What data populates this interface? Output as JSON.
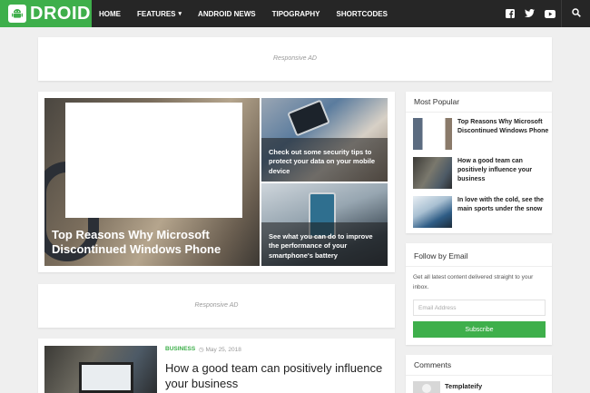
{
  "brand": {
    "name": "DROID",
    "accent_color": "#3eaf4b",
    "logo_icon": "android-icon"
  },
  "nav": {
    "items": [
      {
        "label": "HOME"
      },
      {
        "label": "FEATURES",
        "icon": "chevron-down-icon"
      },
      {
        "label": "ANDROID NEWS"
      },
      {
        "label": "TIPOGRAPHY"
      },
      {
        "label": "SHORTCODES"
      }
    ],
    "social_icons": [
      "facebook-icon",
      "twitter-icon",
      "youtube-icon"
    ],
    "search_icon": "search-icon"
  },
  "ads": {
    "top": "Responsive AD",
    "middle": "Responsive AD"
  },
  "featured": {
    "main": {
      "title": "Top Reasons Why Microsoft Discontinued Windows Phone"
    },
    "side": [
      {
        "title": "Check out some security tips to protect your data on your mobile device"
      },
      {
        "title": "See what you can do to improve the performance of your smartphone's battery"
      }
    ]
  },
  "post": {
    "category": "BUSINESS",
    "date": "May 25, 2018",
    "title": "How a good team can positively influence your business"
  },
  "sidebar": {
    "most_popular": {
      "title": "Most Popular",
      "items": [
        {
          "title": "Top Reasons Why Microsoft Discontinued Windows Phone"
        },
        {
          "title": "How a good team can positively influence your business"
        },
        {
          "title": "In love with the cold, see the main sports under the snow"
        }
      ]
    },
    "follow_by_email": {
      "title": "Follow by Email",
      "description": "Get all latest content delivered straight to your inbox.",
      "input_placeholder": "Email Address",
      "button_label": "Subscribe"
    },
    "comments": {
      "title": "Comments",
      "first_author": "Templateify"
    }
  }
}
